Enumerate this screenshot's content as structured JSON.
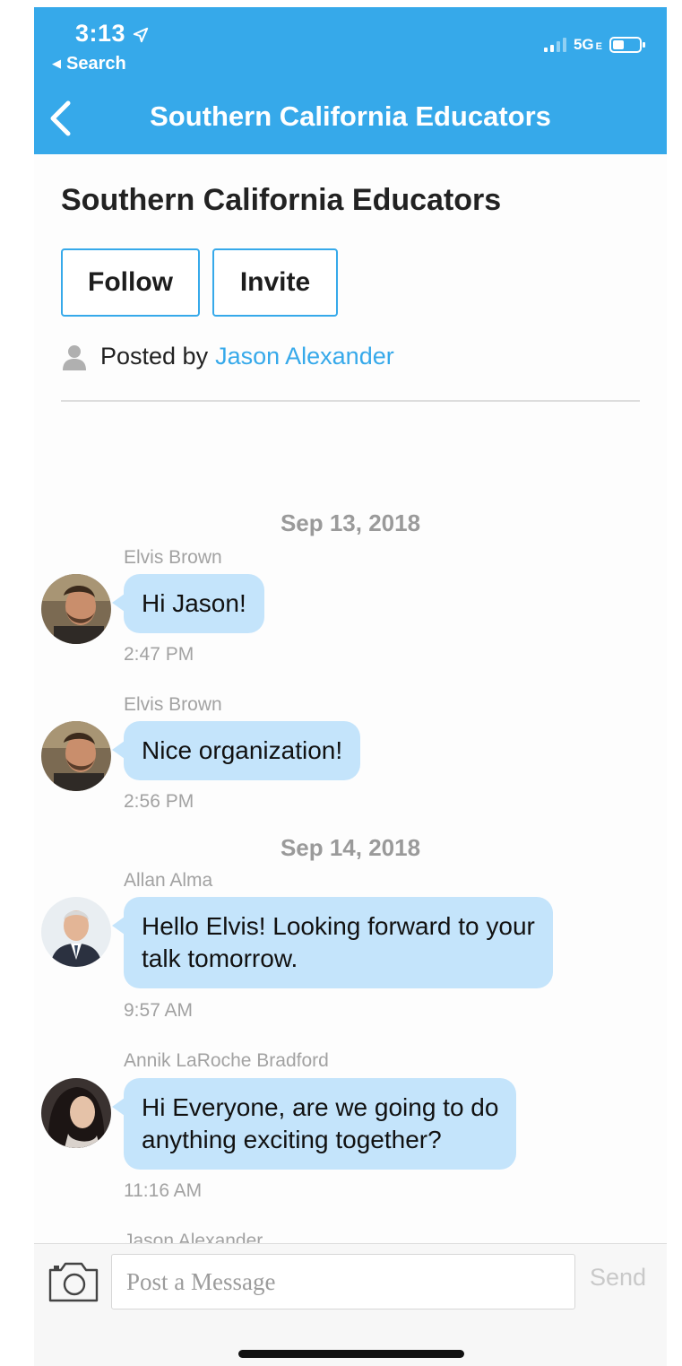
{
  "status_bar": {
    "time": "3:13",
    "back_app": "Search",
    "network": "5G",
    "network_suffix": "E"
  },
  "nav": {
    "title": "Southern California Educators"
  },
  "group": {
    "title": "Southern California Educators",
    "follow_label": "Follow",
    "invite_label": "Invite",
    "posted_by_label": "Posted by",
    "posted_by_name": "Jason Alexander"
  },
  "messages": [
    {
      "date": "Sep 13, 2018",
      "sender": "Elvis Brown",
      "text": "Hi Jason!",
      "time": "2:47 PM"
    },
    {
      "sender": "Elvis Brown",
      "text": "Nice organization!",
      "time": "2:56 PM"
    },
    {
      "date": "Sep 14, 2018",
      "sender": "Allan Alma",
      "text_lines": [
        "Hello Elvis! Looking forward to your",
        "talk tomorrow."
      ],
      "time": "9:57 AM"
    },
    {
      "sender": "Annik LaRoche Bradford",
      "text_lines": [
        "Hi Everyone, are we going to do",
        "anything exciting together?"
      ],
      "time": "11:16 AM"
    },
    {
      "sender": "Jason Alexander"
    }
  ],
  "composer": {
    "placeholder": "Post a Message",
    "send_label": "Send"
  },
  "colors": {
    "accent": "#36a9ea",
    "bubble": "#c4e4fb",
    "muted_text": "#a2a2a2"
  },
  "icons": [
    "location-arrow-icon",
    "back-chevron-icon",
    "person-icon",
    "camera-icon",
    "signal-icon",
    "battery-icon"
  ]
}
